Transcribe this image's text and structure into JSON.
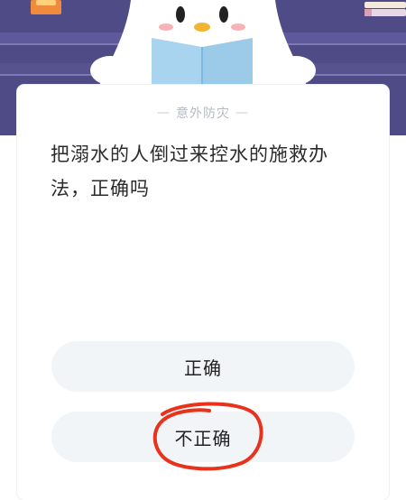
{
  "quiz": {
    "category": "意外防灾",
    "question": "把溺水的人倒过来控水的施救办法，正确吗",
    "options": [
      {
        "label": "正确"
      },
      {
        "label": "不正确"
      }
    ],
    "highlighted_option_index": 1
  },
  "colors": {
    "header_bg": "#4f4b86",
    "card_bg": "#ffffff",
    "option_bg": "#f2f5f8",
    "highlight_stroke": "#e8321c",
    "mascot_body": "#ffffff",
    "mascot_book": "#a9d4ef"
  },
  "icons": {
    "mascot": "penguin-reading-book-icon",
    "shelf_books": "book-stack-icon"
  }
}
